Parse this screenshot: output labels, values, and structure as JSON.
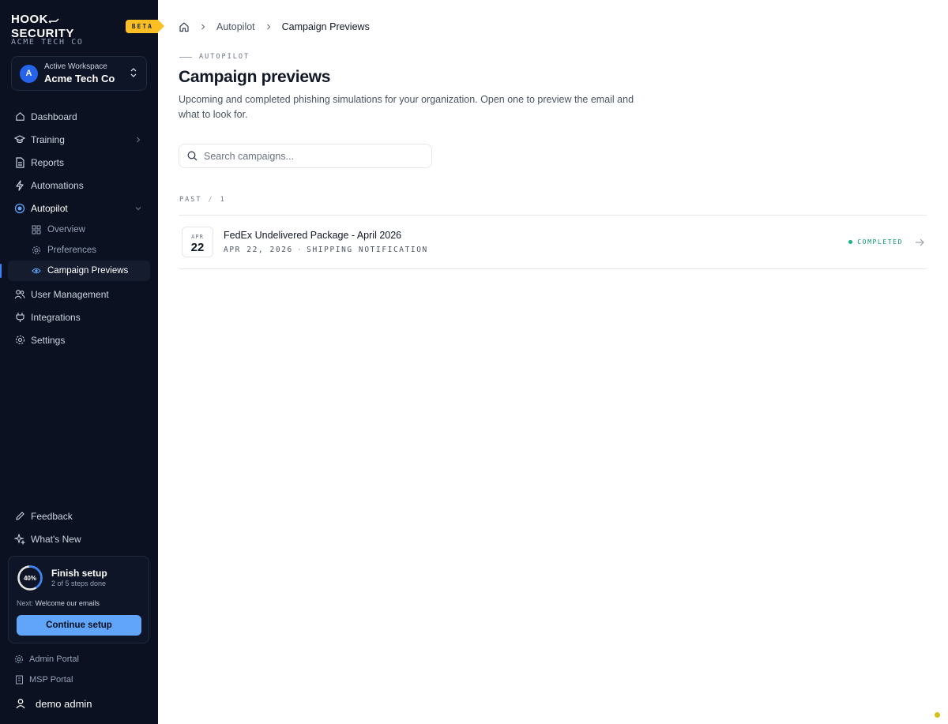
{
  "brand": {
    "logo": "HOOK SECURITY",
    "badge": "BETA",
    "org": "ACME TECH CO"
  },
  "workspace": {
    "label": "Active Workspace",
    "name": "Acme Tech Co",
    "avatar": "A",
    "avatar_color": "#2563eb"
  },
  "nav": {
    "dashboard": "Dashboard",
    "training": "Training",
    "reports": "Reports",
    "automations": "Automations",
    "autopilot": "Autopilot",
    "overview": "Overview",
    "preferences": "Preferences",
    "campaign_previews": "Campaign Previews",
    "user_management": "User Management",
    "integrations": "Integrations",
    "settings": "Settings",
    "feedback": "Feedback",
    "whats_new": "What's New"
  },
  "setup": {
    "progress_label": "40%",
    "progress": 0.4,
    "title": "Finish setup",
    "steps": "2 of 5 steps done",
    "next_prefix": "Next:",
    "next_step": "Welcome our emails",
    "button": "Continue setup"
  },
  "portals": {
    "admin": "Admin Portal",
    "msp": "MSP Portal"
  },
  "user": {
    "name": "demo admin"
  },
  "breadcrumb": {
    "parent": "Autopilot",
    "current": "Campaign Previews"
  },
  "page": {
    "eyebrow": "AUTOPILOT",
    "title": "Campaign previews",
    "description": "Upcoming and completed phishing simulations for your organization. Open one to preview the email and what to look for."
  },
  "search": {
    "placeholder": "Search campaigns...",
    "value": ""
  },
  "group": {
    "label": "PAST",
    "sep": "/",
    "count": "1"
  },
  "campaigns": [
    {
      "month": "APR",
      "day": "22",
      "title": "FedEx Undelivered Package - April 2026",
      "date": "APR 22, 2026",
      "dot": "·",
      "category": "SHIPPING NOTIFICATION",
      "status": "COMPLETED"
    }
  ],
  "colors": {
    "accent": "#3b82f6",
    "sidebar_bg": "#0b1120",
    "badge": "#fbbf24",
    "status_completed": "#10b981",
    "setup_button": "#60a5fa"
  }
}
